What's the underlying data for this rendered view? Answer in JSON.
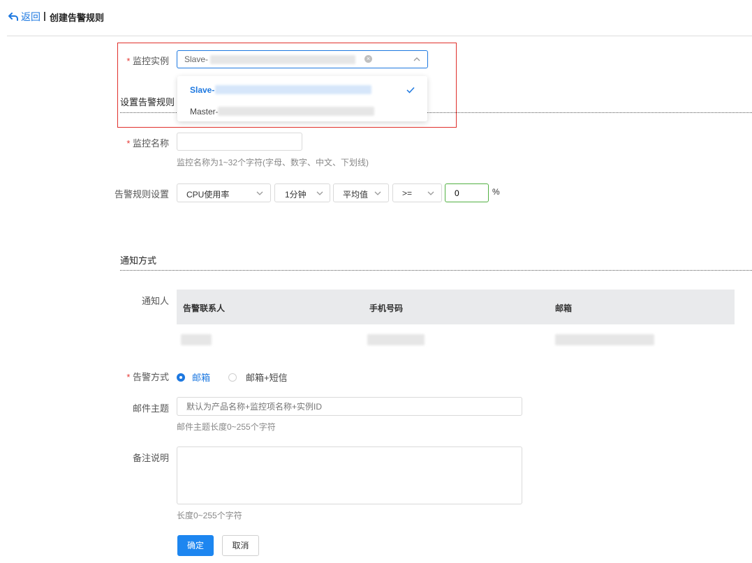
{
  "header": {
    "back_label": "返回",
    "separator": "|",
    "title": "创建告警规则"
  },
  "instance": {
    "label": "监控实例",
    "selected_prefix": "Slave-",
    "options": [
      {
        "label": "Slave-",
        "selected": true
      },
      {
        "label": "Master-",
        "selected": false
      }
    ]
  },
  "rule_section": {
    "title": "设置告警规则",
    "name_label": "监控名称",
    "name_value": "",
    "name_hint": "监控名称为1~32个字符(字母、数字、中文、下划线)",
    "rule_label": "告警规则设置",
    "metric": "CPU使用率",
    "period": "1分钟",
    "aggregate": "平均值",
    "operator": ">=",
    "threshold": "0",
    "unit": "%"
  },
  "notify_section": {
    "title": "通知方式",
    "contacts_label": "通知人",
    "columns": [
      "告警联系人",
      "手机号码",
      "邮箱"
    ],
    "method_label": "告警方式",
    "methods": [
      {
        "label": "邮箱",
        "selected": true
      },
      {
        "label": "邮箱+短信",
        "selected": false
      }
    ],
    "subject_label": "邮件主题",
    "subject_placeholder": "默认为产品名称+监控项名称+实例ID",
    "subject_hint": "邮件主题长度0~255个字符",
    "remark_label": "备注说明",
    "remark_hint": "长度0~255个字符"
  },
  "actions": {
    "confirm": "确定",
    "cancel": "取消"
  },
  "colors": {
    "accent": "#1d78e0",
    "highlight_border": "#e0302b",
    "threshold_border": "#52b043"
  }
}
